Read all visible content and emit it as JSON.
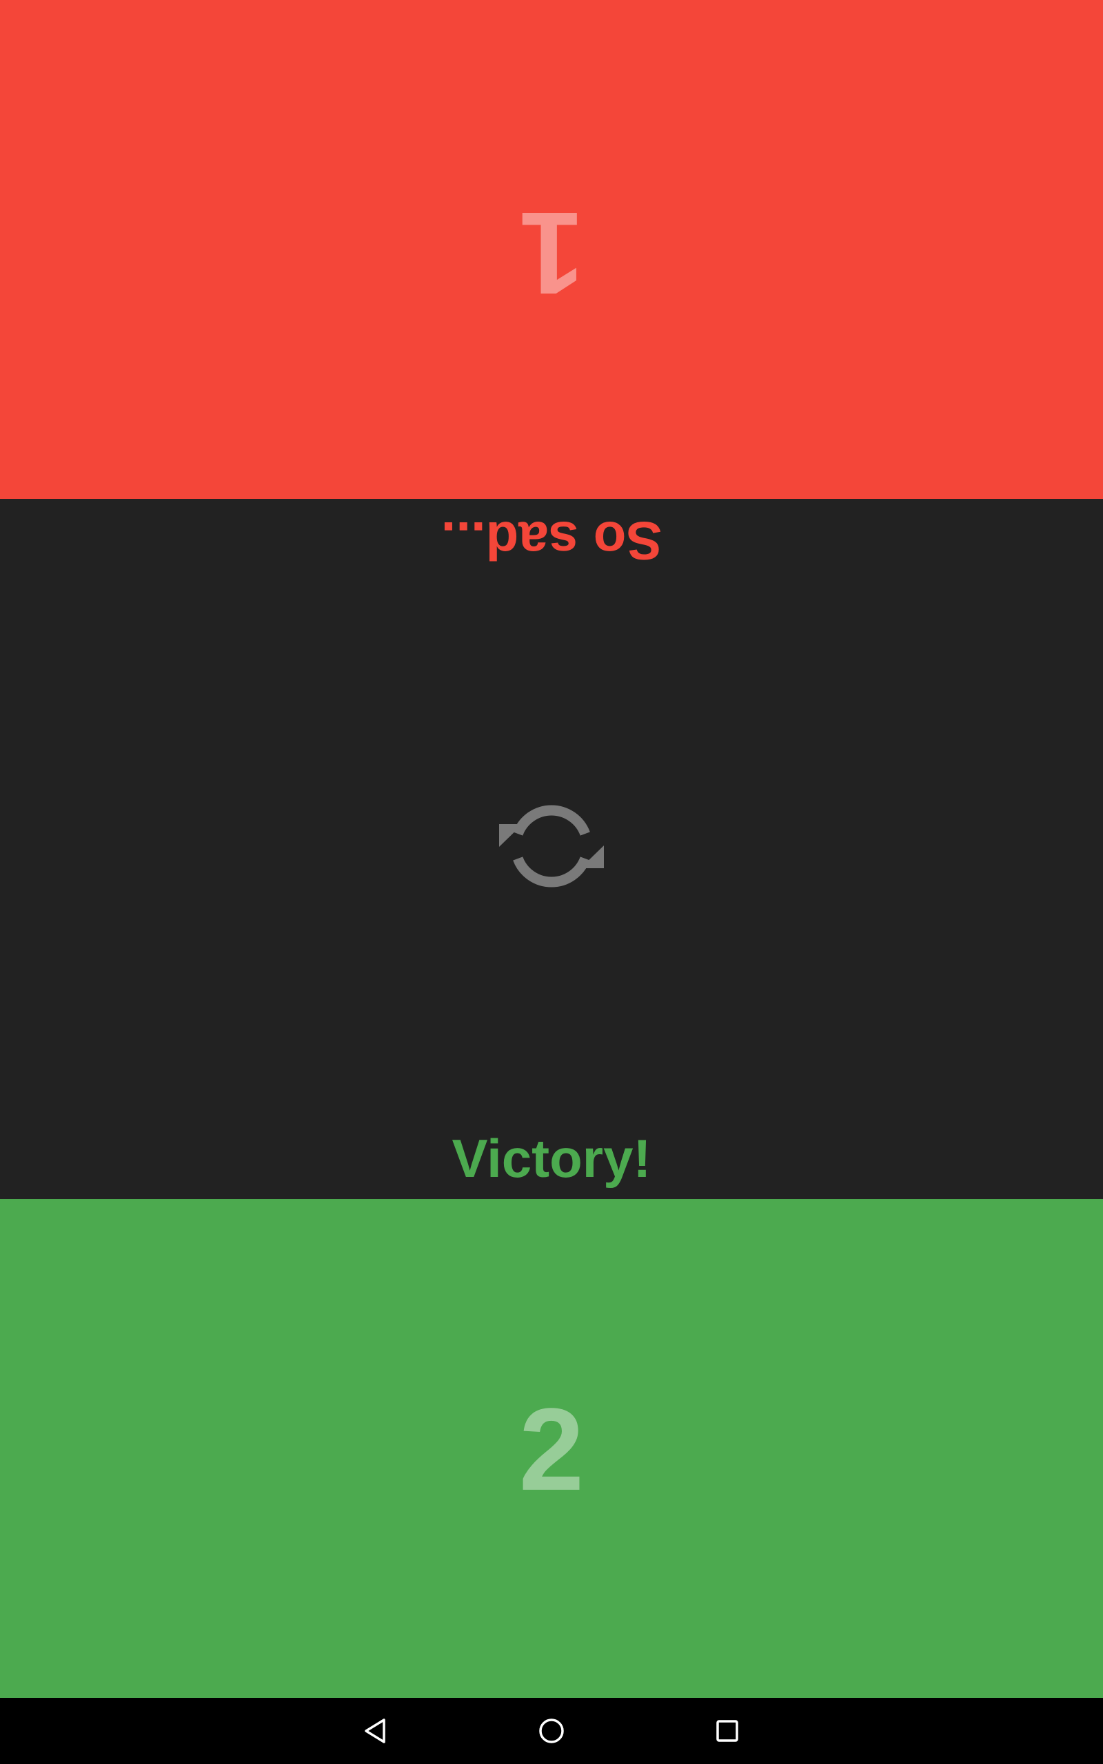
{
  "colors": {
    "loser_panel": "#F44639",
    "winner_panel": "#4CAA4F",
    "middle_background": "#222222",
    "loser_text": "#F44639",
    "winner_text": "#4CAA4F",
    "restart_icon": "#7A7A7A",
    "navbar": "#000000"
  },
  "player_top": {
    "score": "1",
    "status": "So sad..."
  },
  "player_bottom": {
    "score": "2",
    "status": "Victory!"
  },
  "restart": {
    "icon": "refresh-icon"
  },
  "navbar": {
    "back_icon": "back-triangle-icon",
    "home_icon": "home-circle-icon",
    "recents_icon": "recents-square-icon"
  }
}
